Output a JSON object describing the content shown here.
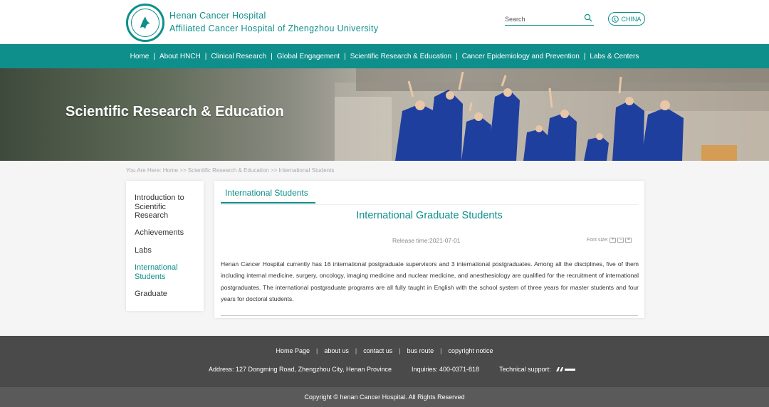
{
  "header": {
    "brand_line1": "Henan Cancer Hospital",
    "brand_line2": "Affiliated Cancer Hospital of Zhengzhou University",
    "search_placeholder": "Search",
    "lang_label": "CHINA"
  },
  "nav": {
    "items": [
      "Home",
      "About HNCH",
      "Clinical Research",
      "Global Engagement",
      "Scientific Research & Education",
      "Cancer Epidemiology and Prevention",
      "Labs & Centers"
    ]
  },
  "banner": {
    "title": "Scientific Research & Education"
  },
  "breadcrumb": {
    "text": "You Are Here:   Home >> Scientific Research & Education >> International Students"
  },
  "sidebar": {
    "items": [
      "Introduction to Scientific Research",
      "Achievements",
      "Labs",
      "International Students",
      "Graduate"
    ],
    "active_index": 3
  },
  "content": {
    "tab": "International Students",
    "title": "International Graduate Students",
    "release": "Release time:2021-07-01",
    "font_size_label": "Font size:",
    "body": "Henan Cancer Hospital currently has 16 international postgraduate supervisors and 3 international postgraduates. Among all the disciplines, five of them including internal medicine, surgery, oncology, imaging medicine and nuclear medicine, and anesthesiology are qualified for the recruitment of international postgraduates. The international postgraduate programs are all fully taught in English with the school system of three years for master students and four years for doctoral students."
  },
  "footer": {
    "links": [
      "Home Page",
      "about us",
      "contact us",
      "bus route",
      "copyright notice"
    ],
    "address": "Address: 127 Dongming Road, Zhengzhou City, Henan Province",
    "inquiries": "Inquiries:  400-0371-818",
    "support": "Technical support:",
    "copyright": "Copyright © henan Cancer Hospital. All Rights Reserved"
  },
  "colors": {
    "accent": "#0e8f8b",
    "footer_bg": "#4a4a4a"
  }
}
